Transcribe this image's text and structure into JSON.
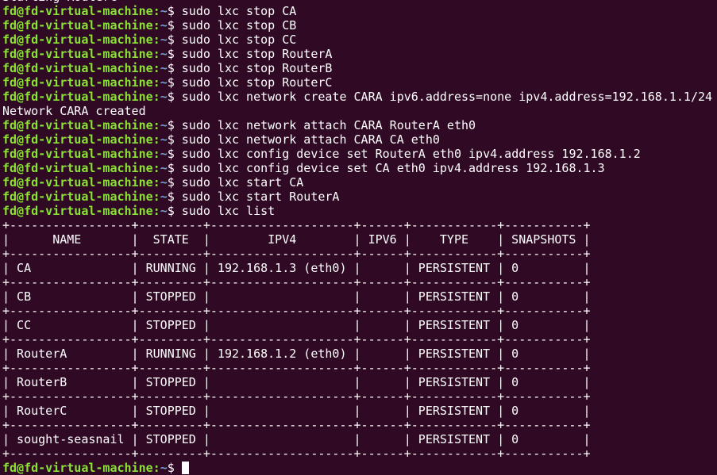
{
  "terminal": {
    "prompt": {
      "user_host": "fd@fd-virtual-machine",
      "sep": ":",
      "path": "~",
      "symbol": "$ "
    },
    "partial_top_line": "Starting RouterC",
    "entries": [
      {
        "cmd": "sudo lxc stop CA"
      },
      {
        "cmd": "sudo lxc stop CB"
      },
      {
        "cmd": "sudo lxc stop CC"
      },
      {
        "cmd": "sudo lxc stop RouterA"
      },
      {
        "cmd": "sudo lxc stop RouterB"
      },
      {
        "cmd": "sudo lxc stop RouterC"
      },
      {
        "cmd": "sudo lxc network create CARA ipv6.address=none ipv4.address=192.168.1.1/24"
      },
      {
        "output": "Network CARA created"
      },
      {
        "cmd": "sudo lxc network attach CARA RouterA eth0"
      },
      {
        "cmd": "sudo lxc network attach CARA CA eth0"
      },
      {
        "cmd": "sudo lxc config device set RouterA eth0 ipv4.address 192.168.1.2"
      },
      {
        "cmd": "sudo lxc config device set CA eth0 ipv4.address 192.168.1.3"
      },
      {
        "cmd": "sudo lxc start CA"
      },
      {
        "cmd": "sudo lxc start RouterA"
      },
      {
        "cmd": "sudo lxc list"
      }
    ],
    "table": {
      "border": "+-----------------+---------+--------------------+------+------------+-----------+",
      "header": "|      NAME       |  STATE  |        IPV4        | IPV6 |    TYPE    | SNAPSHOTS |",
      "rows": [
        "| CA              | RUNNING | 192.168.1.3 (eth0) |      | PERSISTENT | 0         |",
        "| CB              | STOPPED |                    |      | PERSISTENT | 0         |",
        "| CC              | STOPPED |                    |      | PERSISTENT | 0         |",
        "| RouterA         | RUNNING | 192.168.1.2 (eth0) |      | PERSISTENT | 0         |",
        "| RouterB         | STOPPED |                    |      | PERSISTENT | 0         |",
        "| RouterC         | STOPPED |                    |      | PERSISTENT | 0         |",
        "| sought-seasnail | STOPPED |                    |      | PERSISTENT | 0         |"
      ]
    },
    "colors": {
      "background": "#300a24",
      "user_host": "#8ae234",
      "path": "#729fcf",
      "text": "#ffffff"
    }
  }
}
